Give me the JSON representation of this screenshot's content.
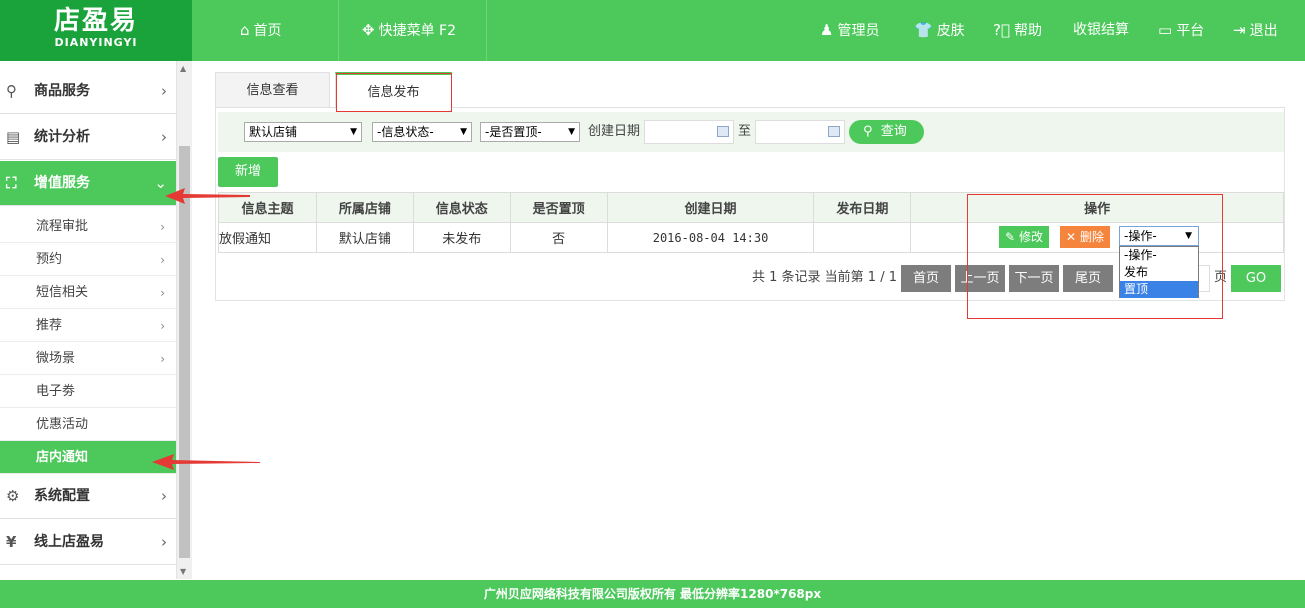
{
  "brand": {
    "cn": "店盈易",
    "en": "DIANYINGYI"
  },
  "topnav": {
    "home": "首页",
    "quick_menu": "快捷菜单 F2",
    "admin": "管理员",
    "skin": "皮肤",
    "help": "帮助",
    "checkout": "收银结算",
    "platform": "平台",
    "logout": "退出"
  },
  "sidebar": {
    "goods": "商品服务",
    "stats": "统计分析",
    "value_added": "增值服务",
    "subs": [
      {
        "label": "流程审批",
        "chevron": true
      },
      {
        "label": "预约",
        "chevron": true
      },
      {
        "label": "短信相关",
        "chevron": true
      },
      {
        "label": "推荐",
        "chevron": true
      },
      {
        "label": "微场景",
        "chevron": true
      },
      {
        "label": "电子劵",
        "chevron": false
      },
      {
        "label": "优惠活动",
        "chevron": false
      },
      {
        "label": "店内通知",
        "chevron": false
      }
    ],
    "system": "系统配置",
    "online": "线上店盈易"
  },
  "tabs": {
    "view": "信息查看",
    "publish": "信息发布"
  },
  "filters": {
    "store": "默认店铺",
    "status": "-信息状态-",
    "top": "-是否置顶-",
    "created_label": "创建日期",
    "to": "至",
    "search": "查询"
  },
  "add_button": "新增",
  "table": {
    "headers": [
      "信息主题",
      "所属店铺",
      "信息状态",
      "是否置顶",
      "创建日期",
      "发布日期",
      "操作"
    ],
    "row": {
      "subject": "放假通知",
      "store": "默认店铺",
      "status": "未发布",
      "top": "否",
      "created": "2016-08-04 14:30",
      "published": ""
    },
    "edit": "修改",
    "delete": "删除",
    "op_select": "-操作-",
    "op_options": [
      "-操作-",
      "发布",
      "置顶"
    ]
  },
  "pager": {
    "info": "共 1 条记录 当前第 1 / 1",
    "first": "首页",
    "prev": "上一页",
    "next": "下一页",
    "last": "尾页",
    "page_unit": "页",
    "go": "GO"
  },
  "footer": "广州贝应网络科技有限公司版权所有 最低分辨率1280*768px",
  "colors": {
    "brand_green": "#4dc95c",
    "dark_green": "#1aa33a",
    "annotation_red": "#e53935",
    "delete_orange": "#f5843c"
  }
}
